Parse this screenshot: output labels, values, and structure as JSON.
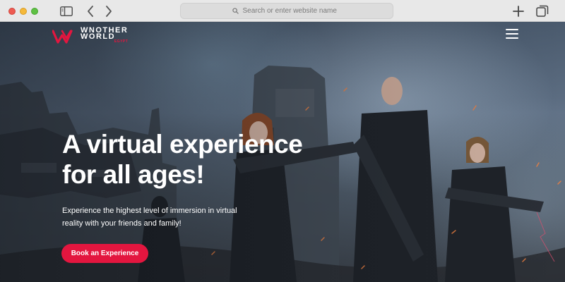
{
  "browser": {
    "url_placeholder": "Search or enter website name"
  },
  "site": {
    "logo": {
      "word_line1": "WNOTHER",
      "word_line2": "WORLD",
      "sub": "EGYPT"
    },
    "hero": {
      "headline_line1": "A virtual experience",
      "headline_line2": "for all ages!",
      "subtext": "Experience the highest level of immersion in virtual reality with your friends and family!",
      "cta_label": "Book an Experience"
    }
  },
  "colors": {
    "brand_red": "#e3163f",
    "chrome_bg": "#e8e8e8"
  },
  "icons": [
    "sidebar-icon",
    "chevron-left-icon",
    "chevron-right-icon",
    "search-icon",
    "plus-icon",
    "tabs-icon",
    "hamburger-menu-icon"
  ]
}
